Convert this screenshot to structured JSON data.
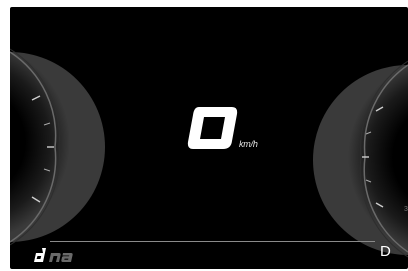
{
  "cluster": {
    "speed_value": "0",
    "speed_unit": "km/h",
    "drive_mode_logo": "dna",
    "gear": "D"
  },
  "colors": {
    "background": "#000000",
    "text": "#ffffff",
    "accent_gray": "#8a8a8a"
  },
  "icons": {
    "drive_mode": "dna-logo"
  }
}
